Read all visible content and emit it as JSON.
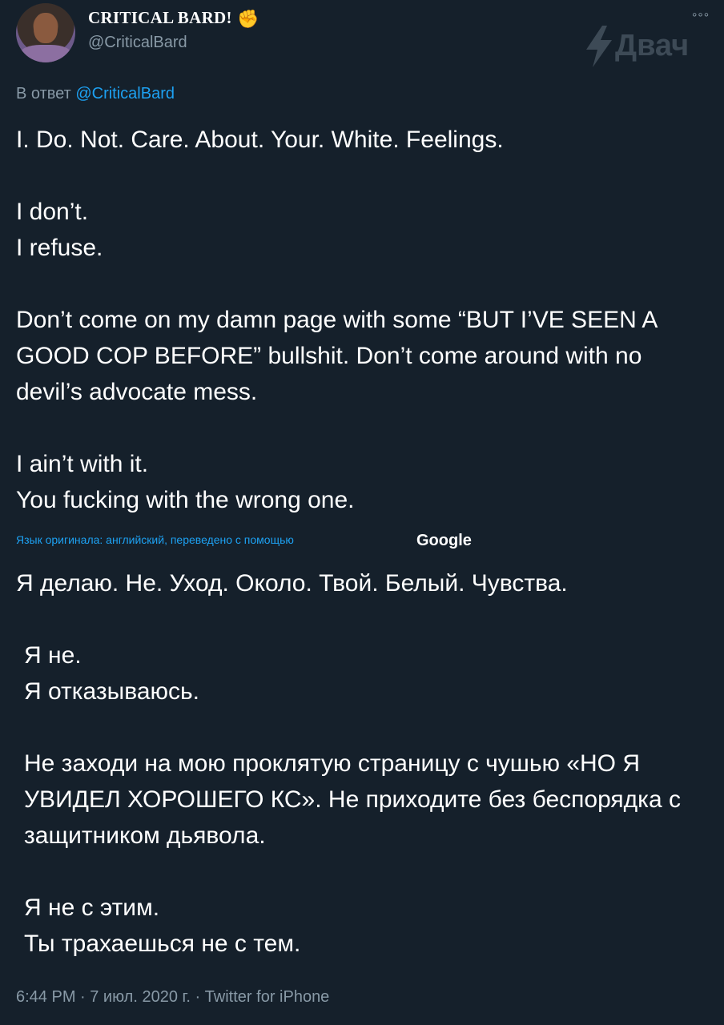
{
  "tweet": {
    "display_name": "CRITICAL BARD!",
    "handle": "@CriticalBard",
    "emoji_icon": "raised-fist-medium-dark-skin",
    "more_icon": "°°°",
    "watermark_text": "Двач",
    "reply_prefix": "В ответ",
    "reply_mention": "@CriticalBard",
    "original_lines": [
      "I. Do. Not. Care. About. Your. White. Feelings.",
      "",
      "I don’t.",
      "I refuse.",
      "",
      "Don’t come on my damn page with some “BUT I’VE SEEN A GOOD COP BEFORE” bullshit. Don’t come around with no devil’s advocate mess.",
      "",
      "I ain’t with it.",
      "You fucking with the wrong one."
    ],
    "translation_label": "Язык оригинала: английский, переведено с помощью",
    "google_label": "Google",
    "translated_lines": [
      "Я делаю. Не. Уход. Около. Твой. Белый. Чувства.",
      "",
      "Я не.",
      "Я отказываюсь.",
      "",
      "Не заходи на мою проклятую страницу с чушью «НО Я УВИДЕЛ ХОРОШЕГО КС». Не приходите без беспорядка с защитником дьявола.",
      "",
      "Я не с этим.",
      "Ты трахаешься не с тем."
    ],
    "footer": "6:44 PM · 7 июл. 2020 г. · Twitter for iPhone"
  },
  "colors": {
    "background": "#15202b",
    "text": "#ffffff",
    "secondary": "#8899a6",
    "link": "#1da1f2"
  }
}
